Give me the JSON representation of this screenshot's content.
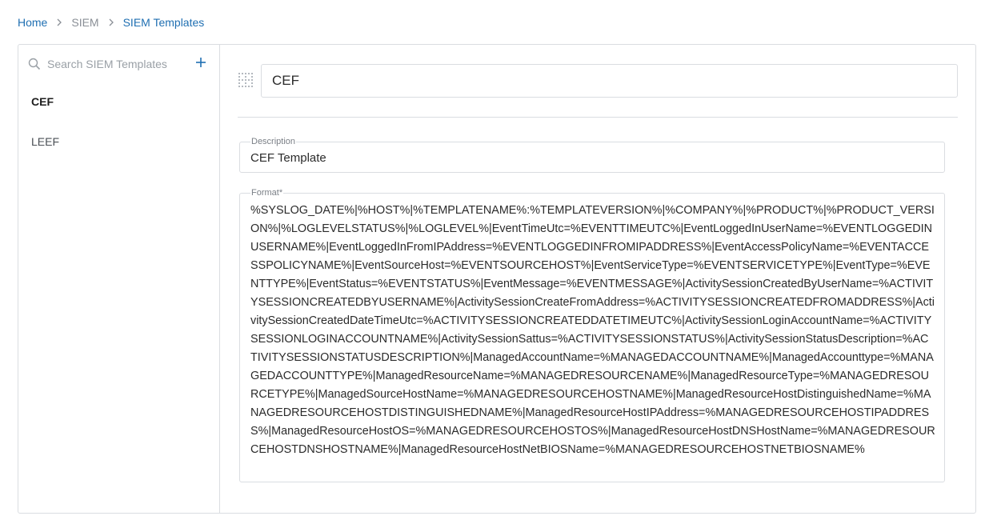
{
  "breadcrumb": {
    "home": "Home",
    "siem": "SIEM",
    "current": "SIEM Templates"
  },
  "sidebar": {
    "search_placeholder": "Search SIEM Templates",
    "items": [
      {
        "label": "CEF",
        "active": true
      },
      {
        "label": "LEEF",
        "active": false
      }
    ]
  },
  "main": {
    "template_name": "CEF",
    "description_label": "Description",
    "description_value": "CEF Template",
    "format_label": "Format*",
    "format_value": "%SYSLOG_DATE%|%HOST%|%TEMPLATENAME%:%TEMPLATEVERSION%|%COMPANY%|%PRODUCT%|%PRODUCT_VERSION%|%LOGLEVELSTATUS%|%LOGLEVEL%|EventTimeUtc=%EVENTTIMEUTC%|EventLoggedInUserName=%EVENTLOGGEDINUSERNAME%|EventLoggedInFromIPAddress=%EVENTLOGGEDINFROMIPADDRESS%|EventAccessPolicyName=%EVENTACCESSPOLICYNAME%|EventSourceHost=%EVENTSOURCEHOST%|EventServiceType=%EVENTSERVICETYPE%|EventType=%EVENTTYPE%|EventStatus=%EVENTSTATUS%|EventMessage=%EVENTMESSAGE%|ActivitySessionCreatedByUserName=%ACTIVITYSESSIONCREATEDBYUSERNAME%|ActivitySessionCreateFromAddress=%ACTIVITYSESSIONCREATEDFROMADDRESS%|ActivitySessionCreatedDateTimeUtc=%ACTIVITYSESSIONCREATEDDATETIMEUTC%|ActivitySessionLoginAccountName=%ACTIVITYSESSIONLOGINACCOUNTNAME%|ActivitySessionSattus=%ACTIVITYSESSIONSTATUS%|ActivitySessionStatusDescription=%ACTIVITYSESSIONSTATUSDESCRIPTION%|ManagedAccountName=%MANAGEDACCOUNTNAME%|ManagedAccounttype=%MANAGEDACCOUNTTYPE%|ManagedResourceName=%MANAGEDRESOURCENAME%|ManagedResourceType=%MANAGEDRESOURCETYPE%|ManagedSourceHostName=%MANAGEDRESOURCEHOSTNAME%|ManagedResourceHostDistinguishedName=%MANAGEDRESOURCEHOSTDISTINGUISHEDNAME%|ManagedResourceHostIPAddress=%MANAGEDRESOURCEHOSTIPADDRESS%|ManagedResourceHostOS=%MANAGEDRESOURCEHOSTOS%|ManagedResourceHostDNSHostName=%MANAGEDRESOURCEHOSTDNSHOSTNAME%|ManagedResourceHostNetBIOSName=%MANAGEDRESOURCEHOSTNETBIOSNAME%"
  },
  "icons": {
    "search": "search-icon",
    "add": "plus-icon",
    "template": "grid-icon",
    "separator": "chevron-right-icon"
  },
  "colors": {
    "link": "#1f6fb2",
    "border": "#dadde1",
    "muted": "#8a8f96"
  }
}
